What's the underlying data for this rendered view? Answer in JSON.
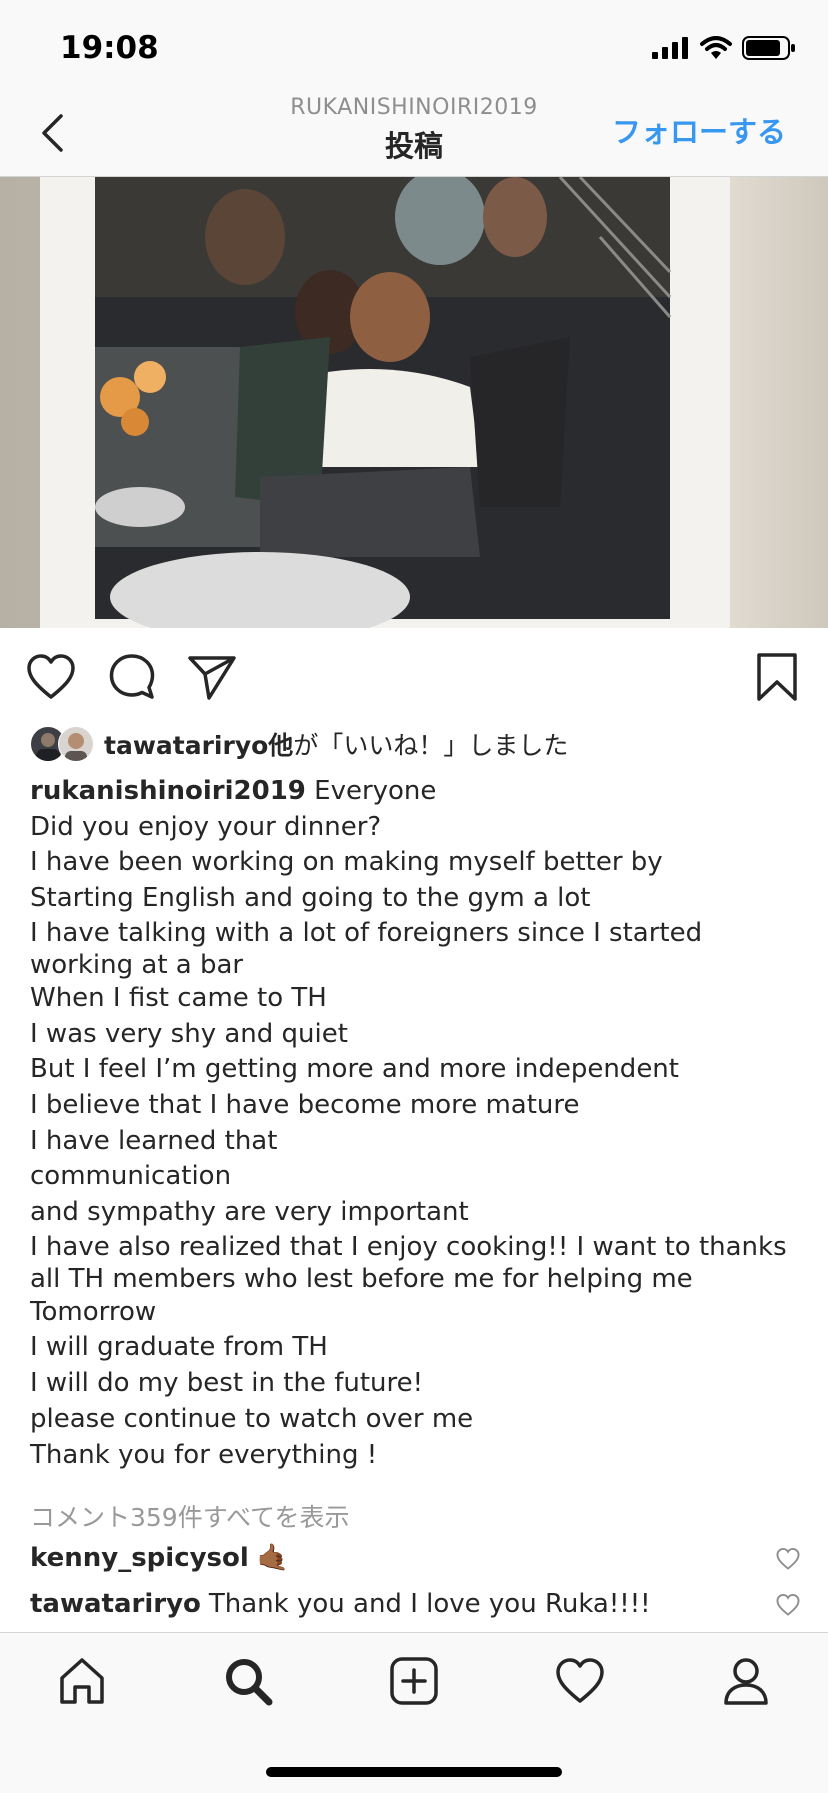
{
  "status_bar": {
    "time": "19:08"
  },
  "header": {
    "username": "RUKANISHINOIRI2019",
    "title": "投稿",
    "follow_label": "フォローする"
  },
  "likes": {
    "user": "tawatariryo他",
    "suffix": "が「いいね！」しました"
  },
  "caption": {
    "username": "rukanishinoiri2019",
    "first_line": "Everyone",
    "lines": [
      "Did you enjoy your dinner?",
      "I have been working on making myself better by",
      "Starting English and going to the gym a lot",
      "I have talking with a lot of foreigners since I started working at a bar",
      "When I fist came to TH",
      "I was very shy and quiet",
      "But I feel I’m getting more and more independent",
      "I believe that I have become more mature",
      "I have learned that",
      "communication",
      "and sympathy are very important",
      "I have also realized that I enjoy cooking!! I want to thanks all TH members who lest before me for helping me",
      "Tomorrow",
      "I will graduate from TH",
      "I will do my best in the future!",
      "please continue to watch over me",
      "Thank you for everything !"
    ]
  },
  "view_comments": "コメント359件すべてを表示",
  "comments": [
    {
      "user": "kenny_spicysol",
      "text": "🤙🏾"
    },
    {
      "user": "tawatariryo",
      "text": "Thank you and I love you Ruka!!!!"
    }
  ],
  "icons": {
    "back": "chevron-left-icon",
    "like": "heart-icon",
    "comment": "comment-bubble-icon",
    "share": "paper-plane-icon",
    "save": "bookmark-icon",
    "tabs": [
      "home-icon",
      "search-icon",
      "add-post-icon",
      "activity-heart-icon",
      "profile-icon"
    ]
  },
  "colors": {
    "accent": "#3897f0",
    "text": "#262626",
    "muted": "#999999",
    "bar_bg": "#f9f9f9"
  }
}
